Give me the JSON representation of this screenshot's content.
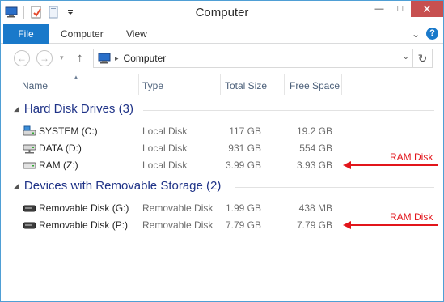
{
  "window": {
    "title": "Computer",
    "controls": {
      "minimize": "—",
      "maximize": "□",
      "close": "✕"
    }
  },
  "ribbon": {
    "tabs": [
      {
        "label": "File"
      },
      {
        "label": "Computer"
      },
      {
        "label": "View"
      }
    ],
    "help_label": "?",
    "collapse_label": "⌄"
  },
  "address": {
    "location": "Computer",
    "separator": "▸",
    "back_glyph": "←",
    "forward_glyph": "→",
    "recent_glyph": "▾",
    "up_glyph": "↑",
    "dropdown_glyph": "⌄",
    "refresh_glyph": "↻"
  },
  "columns": {
    "name": "Name",
    "type": "Type",
    "total_size": "Total Size",
    "free_space": "Free Space",
    "sort_glyph": "▲"
  },
  "groups": [
    {
      "title": "Hard Disk Drives (3)",
      "chevron": "◢",
      "items": [
        {
          "name": "SYSTEM (C:)",
          "type": "Local Disk",
          "total": "117 GB",
          "free": "19.2 GB",
          "icon": "system-drive-icon"
        },
        {
          "name": "DATA (D:)",
          "type": "Local Disk",
          "total": "931 GB",
          "free": "554 GB",
          "icon": "network-drive-icon"
        },
        {
          "name": "RAM (Z:)",
          "type": "Local Disk",
          "total": "3.99 GB",
          "free": "3.93 GB",
          "icon": "hard-drive-icon"
        }
      ]
    },
    {
      "title": "Devices with Removable Storage (2)",
      "chevron": "◢",
      "items": [
        {
          "name": "Removable Disk (G:)",
          "type": "Removable Disk",
          "total": "1.99 GB",
          "free": "438 MB",
          "icon": "removable-drive-icon"
        },
        {
          "name": "Removable Disk (P:)",
          "type": "Removable Disk",
          "total": "7.79 GB",
          "free": "7.79 GB",
          "icon": "removable-drive-icon"
        }
      ]
    }
  ],
  "annotations": [
    {
      "label": "RAM Disk",
      "color": "#e2151b"
    },
    {
      "label": "RAM Disk",
      "color": "#e2151b"
    }
  ],
  "colors": {
    "accent": "#1979ca",
    "group_heading": "#1e3287",
    "close_button": "#c75050",
    "annotation": "#e2151b"
  }
}
